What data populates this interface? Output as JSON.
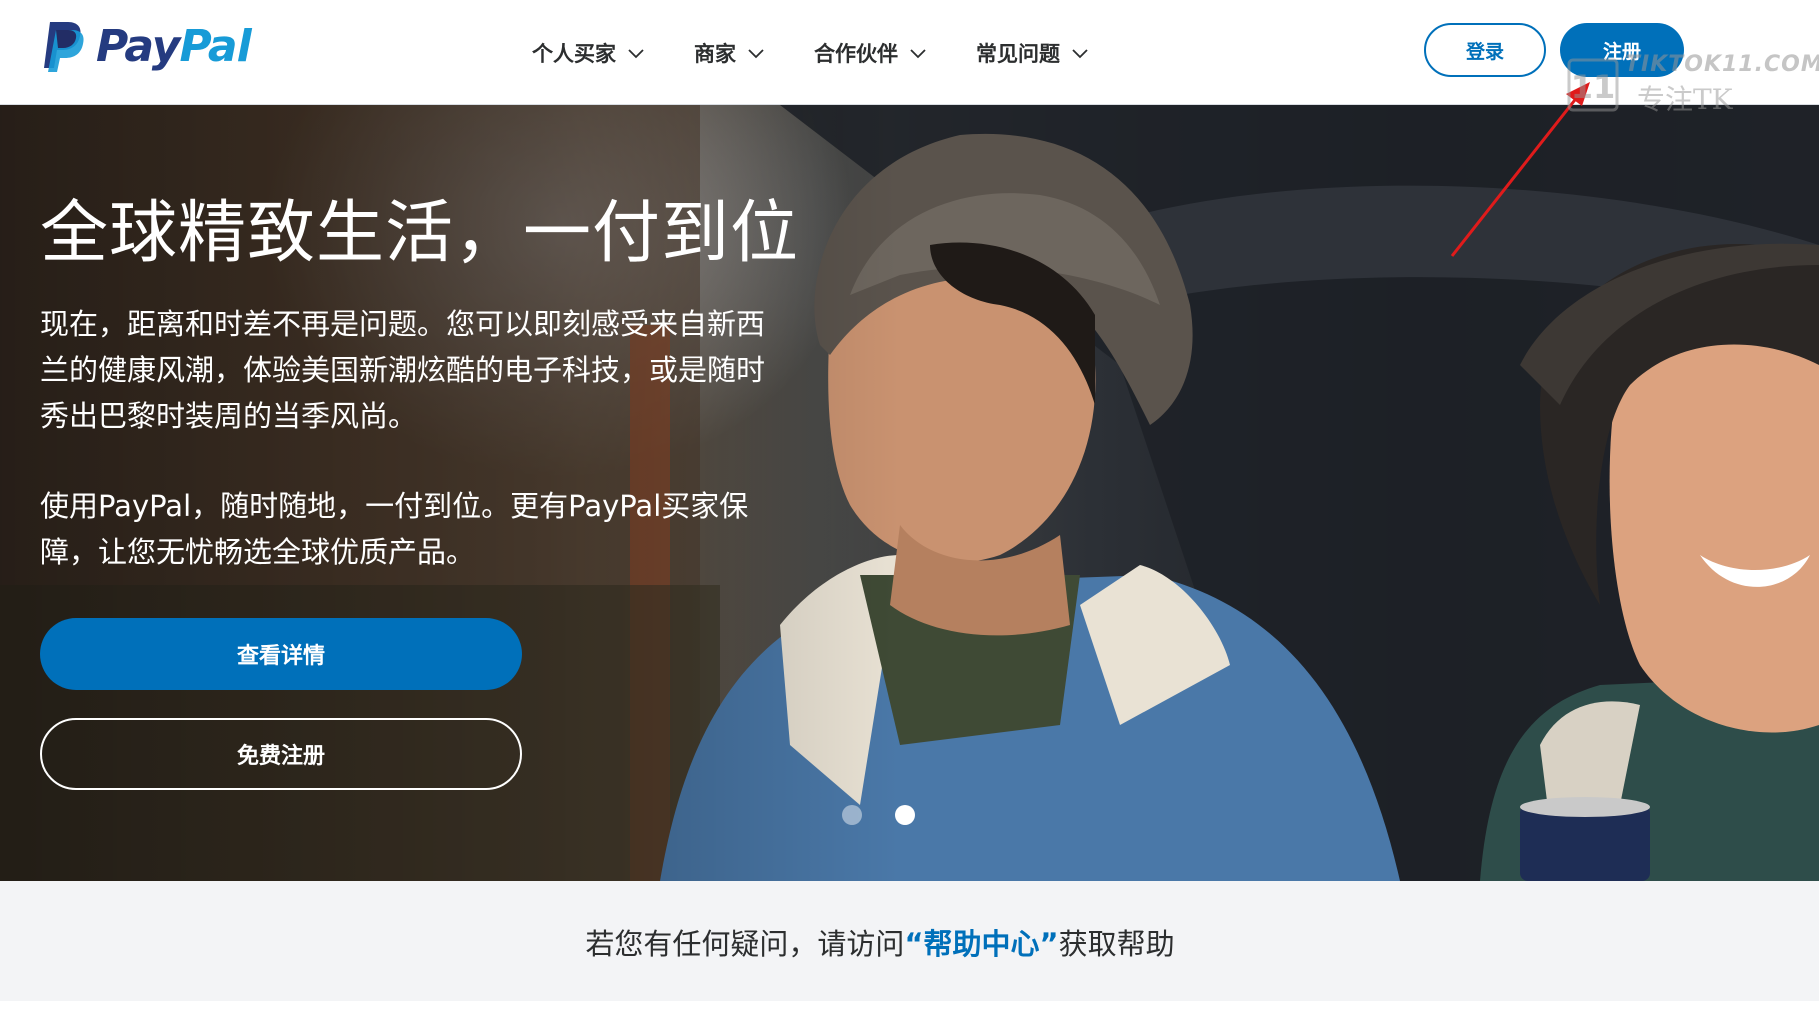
{
  "header": {
    "logo_text_pay": "Pay",
    "logo_text_pal": "Pal",
    "nav": [
      {
        "label": "个人买家"
      },
      {
        "label": "商家"
      },
      {
        "label": "合作伙伴"
      },
      {
        "label": "常见问题"
      }
    ],
    "login_label": "登录",
    "signup_label": "注册"
  },
  "watermark": {
    "line1": "TIKTOK11.COM",
    "line2": "专注TK",
    "badge": "11"
  },
  "hero": {
    "title": "全球精致生活，一付到位",
    "paragraph1": "现在，距离和时差不再是问题。您可以即刻感受来自新西兰的健康风潮，体验美国新潮炫酷的电子科技，或是随时秀出巴黎时装周的当季风尚。",
    "paragraph2": "使用PayPal，随时随地，一付到位。更有PayPal买家保障，让您无忧畅选全球优质产品。",
    "details_button": "查看详情",
    "free_signup_button": "免费注册",
    "carousel_active_index": 2,
    "carousel_count": 2
  },
  "help": {
    "prefix": "若您有任何疑问，请访问",
    "link": "“帮助中心”",
    "suffix": "获取帮助"
  },
  "colors": {
    "brand_blue": "#0070ba",
    "logo_dark": "#253b80",
    "logo_light": "#179bd7",
    "help_bg": "#f3f4f6",
    "annotation_arrow": "#e01b1b"
  }
}
